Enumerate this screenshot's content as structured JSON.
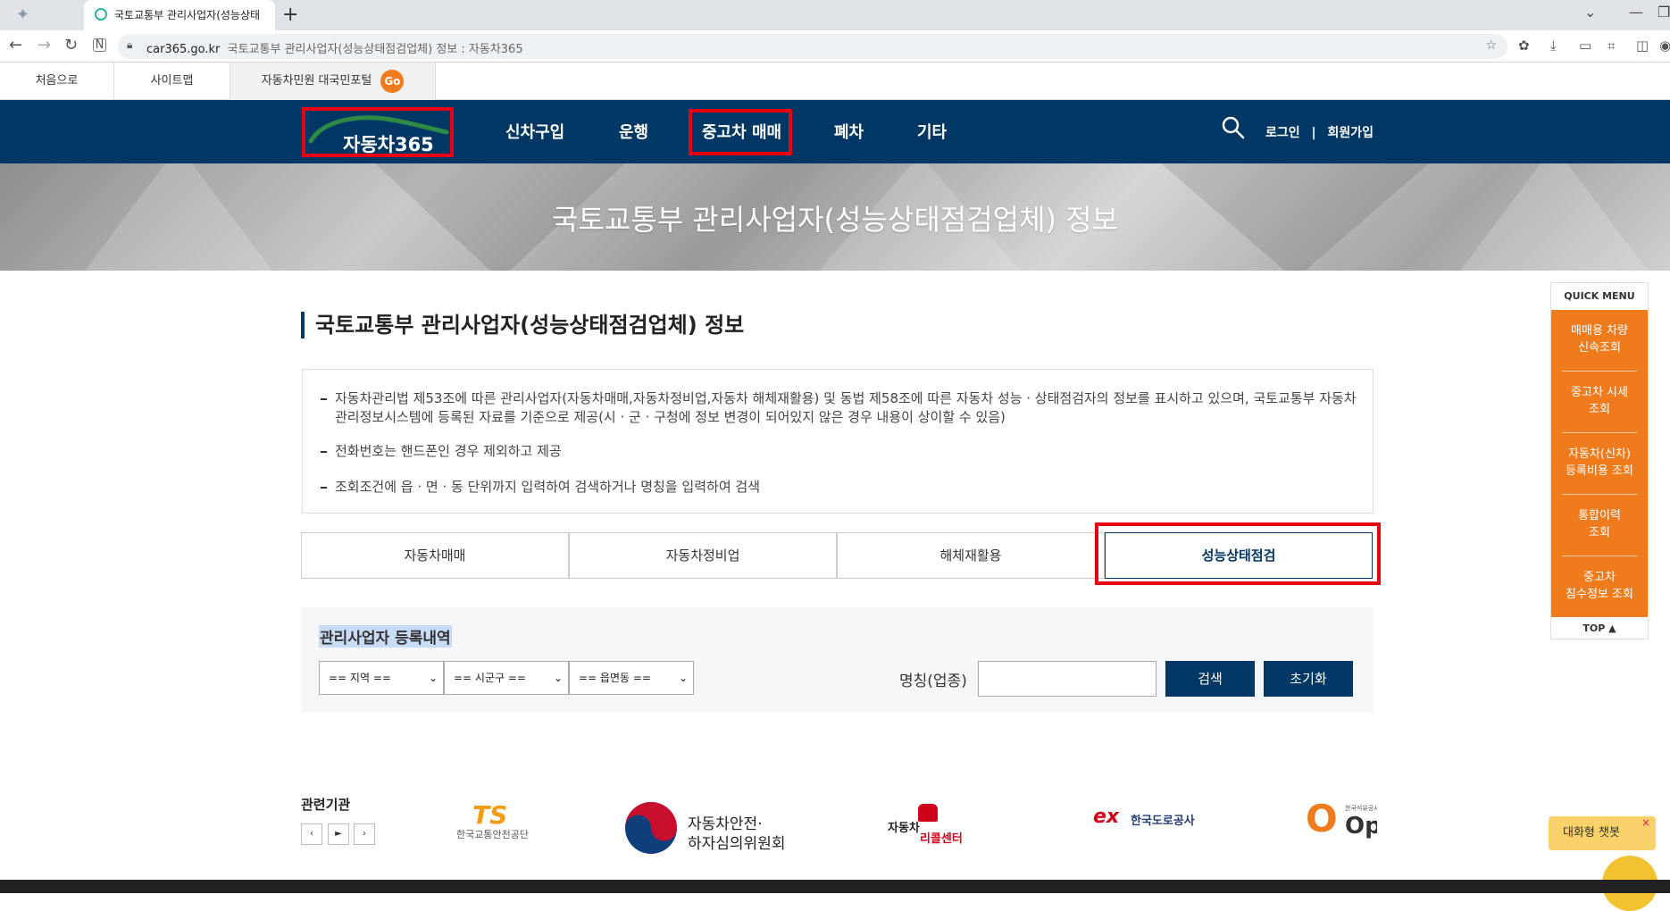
{
  "browser": {
    "tab_title": "국토교통부 관리사업자(성능상태",
    "new_tab": "+",
    "url_domain": "car365.go.kr",
    "url_rest": "국토교통부 관리사업자(성능상태점검업체) 정보 : 자동차365"
  },
  "utility": {
    "home": "처음으로",
    "sitemap": "사이트맵",
    "portal": "자동차민원 대국민포털",
    "go": "Go"
  },
  "nav": {
    "logo": "자동차365",
    "menus": [
      "신차구입",
      "운행",
      "중고차 매매",
      "폐차",
      "기타"
    ],
    "login": "로그인",
    "divider": "|",
    "signup": "회원가입"
  },
  "banner": {
    "title": "국토교통부 관리사업자(성능상태점검업체) 정보"
  },
  "page": {
    "title": "국토교통부 관리사업자(성능상태점검업체) 정보",
    "notices": [
      "자동차관리법 제53조에 따른 관리사업자(자동차매매,자동차정비업,자동차 해체재활용) 및 동법 제58조에 따른 자동차 성능 · 상태점검자의 정보를 표시하고 있으며, 국토교통부 자동차관리정보시스템에 등록된 자료를 기준으로 제공(시 · 군 · 구청에 정보 변경이 되어있지 않은 경우 내용이 상이할 수 있음)",
      "전화번호는 핸드폰인 경우 제외하고 제공",
      "조회조건에 읍 · 면 · 동 단위까지 입력하여 검색하거나 명칭을 입력하여 검색"
    ],
    "tabs": [
      "자동차매매",
      "자동차정비업",
      "해체재활용",
      "성능상태점검"
    ],
    "active_tab": "성능상태점검"
  },
  "search": {
    "title": "관리사업자 등록내역",
    "region": "== 지역 ==",
    "district": "== 시군구 ==",
    "town": "== 읍면동 ==",
    "name_label": "명칭(업종)",
    "name_value": "",
    "search_btn": "검색",
    "reset_btn": "초기화"
  },
  "quick": {
    "title": "QUICK MENU",
    "items": [
      [
        "매매용 차량",
        "신속조회"
      ],
      [
        "중고차 시세",
        "조회"
      ],
      [
        "자동차(신차)",
        "등록비용 조회"
      ],
      [
        "통합이력",
        "조회"
      ],
      [
        "중고차",
        "침수정보 조회"
      ]
    ],
    "top": "TOP ▲"
  },
  "related": {
    "title": "관련기관",
    "prev": "‹",
    "play": "►",
    "next": "›",
    "orgs": {
      "ts_mark": "TS",
      "ts_name": "한국교통안전공단",
      "kars_line1": "자동차안전·",
      "kars_line2": "하자심의위원회",
      "recall_top": "자동차",
      "recall_bottom": "리콜센터",
      "ex_mark": "ex",
      "ex_name": "한국도로공사",
      "opinet": "Opinet",
      "opinet_small": "한국석유공사"
    }
  },
  "chatbot": {
    "label": "대화형 챗봇",
    "close": "×"
  },
  "colors": {
    "navy": "#003764",
    "orange": "#f07b1d",
    "highlight": "#e60012"
  }
}
